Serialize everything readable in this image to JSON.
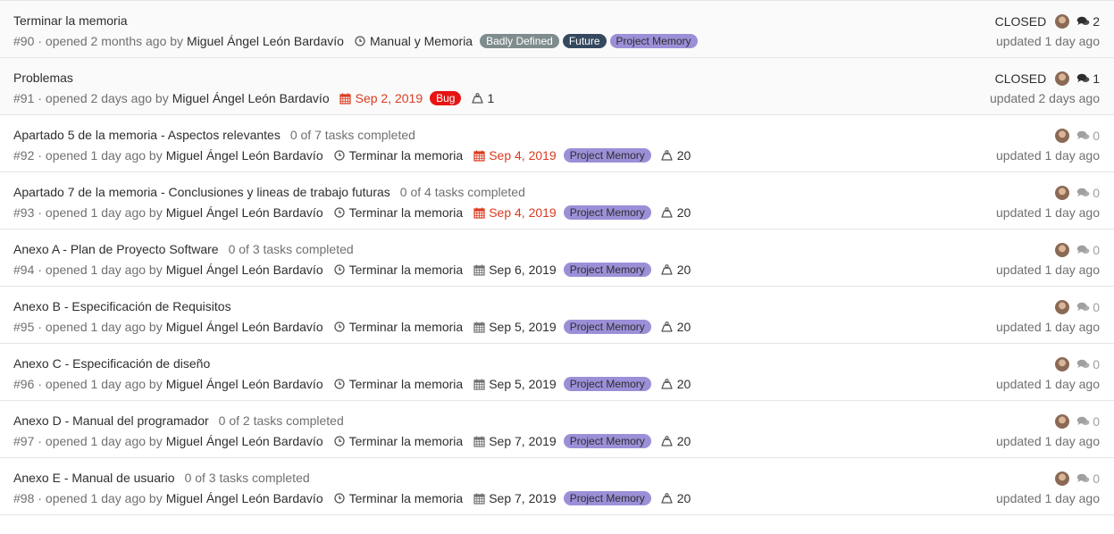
{
  "colors": {
    "badly_defined": "#7f8c8d",
    "future": "#34495e",
    "project_memory": "#9c8fd8",
    "bug": "#e81313",
    "overdue": "#db3b21"
  },
  "issues": [
    {
      "title": "Terminar la memoria",
      "tasks": "",
      "number": "#90",
      "opened": "· opened 2 months ago by",
      "author": "Miguel Ángel León Bardavío",
      "milestone": "Manual y Memoria",
      "due_date": "",
      "weight": "",
      "labels": [
        {
          "text": "Badly Defined",
          "color": "#7f8c8d",
          "text_color": "#ffffff"
        },
        {
          "text": "Future",
          "color": "#34495e",
          "text_color": "#ffffff"
        },
        {
          "text": "Project Memory",
          "color": "#9c8fd8",
          "text_color": "#2e2e2e"
        }
      ],
      "state": "CLOSED",
      "comments": "2",
      "updated": "updated 1 day ago"
    },
    {
      "title": "Problemas",
      "tasks": "",
      "number": "#91",
      "opened": "· opened 2 days ago by",
      "author": "Miguel Ángel León Bardavío",
      "milestone": "",
      "due_date": "Sep 2, 2019",
      "due_overdue": true,
      "weight": "1",
      "labels": [
        {
          "text": "Bug",
          "color": "#e81313",
          "text_color": "#ffffff"
        }
      ],
      "state": "CLOSED",
      "comments": "1",
      "updated": "updated 2 days ago"
    },
    {
      "title": "Apartado 5 de la memoria - Aspectos relevantes",
      "tasks": "0 of 7 tasks completed",
      "number": "#92",
      "opened": "· opened 1 day ago by",
      "author": "Miguel Ángel León Bardavío",
      "milestone": "Terminar la memoria",
      "due_date": "Sep 4, 2019",
      "due_overdue": true,
      "weight": "20",
      "labels": [
        {
          "text": "Project Memory",
          "color": "#9c8fd8",
          "text_color": "#2e2e2e"
        }
      ],
      "state": "",
      "comments": "0",
      "updated": "updated 1 day ago"
    },
    {
      "title": "Apartado 7 de la memoria - Conclusiones y lineas de trabajo futuras",
      "tasks": "0 of 4 tasks completed",
      "number": "#93",
      "opened": "· opened 1 day ago by",
      "author": "Miguel Ángel León Bardavío",
      "milestone": "Terminar la memoria",
      "due_date": "Sep 4, 2019",
      "due_overdue": true,
      "weight": "20",
      "labels": [
        {
          "text": "Project Memory",
          "color": "#9c8fd8",
          "text_color": "#2e2e2e"
        }
      ],
      "state": "",
      "comments": "0",
      "updated": "updated 1 day ago"
    },
    {
      "title": "Anexo A - Plan de Proyecto Software",
      "tasks": "0 of 3 tasks completed",
      "number": "#94",
      "opened": "· opened 1 day ago by",
      "author": "Miguel Ángel León Bardavío",
      "milestone": "Terminar la memoria",
      "due_date": "Sep 6, 2019",
      "due_overdue": false,
      "weight": "20",
      "labels": [
        {
          "text": "Project Memory",
          "color": "#9c8fd8",
          "text_color": "#2e2e2e"
        }
      ],
      "state": "",
      "comments": "0",
      "updated": "updated 1 day ago"
    },
    {
      "title": "Anexo B - Especificación de Requisitos",
      "tasks": "",
      "number": "#95",
      "opened": "· opened 1 day ago by",
      "author": "Miguel Ángel León Bardavío",
      "milestone": "Terminar la memoria",
      "due_date": "Sep 5, 2019",
      "due_overdue": false,
      "weight": "20",
      "labels": [
        {
          "text": "Project Memory",
          "color": "#9c8fd8",
          "text_color": "#2e2e2e"
        }
      ],
      "state": "",
      "comments": "0",
      "updated": "updated 1 day ago"
    },
    {
      "title": "Anexo C - Especificación de diseño",
      "tasks": "",
      "number": "#96",
      "opened": "· opened 1 day ago by",
      "author": "Miguel Ángel León Bardavío",
      "milestone": "Terminar la memoria",
      "due_date": "Sep 5, 2019",
      "due_overdue": false,
      "weight": "20",
      "labels": [
        {
          "text": "Project Memory",
          "color": "#9c8fd8",
          "text_color": "#2e2e2e"
        }
      ],
      "state": "",
      "comments": "0",
      "updated": "updated 1 day ago"
    },
    {
      "title": "Anexo D - Manual del programador",
      "tasks": "0 of 2 tasks completed",
      "number": "#97",
      "opened": "· opened 1 day ago by",
      "author": "Miguel Ángel León Bardavío",
      "milestone": "Terminar la memoria",
      "due_date": "Sep 7, 2019",
      "due_overdue": false,
      "weight": "20",
      "labels": [
        {
          "text": "Project Memory",
          "color": "#9c8fd8",
          "text_color": "#2e2e2e"
        }
      ],
      "state": "",
      "comments": "0",
      "updated": "updated 1 day ago"
    },
    {
      "title": "Anexo E - Manual de usuario",
      "tasks": "0 of 3 tasks completed",
      "number": "#98",
      "opened": "· opened 1 day ago by",
      "author": "Miguel Ángel León Bardavío",
      "milestone": "Terminar la memoria",
      "due_date": "Sep 7, 2019",
      "due_overdue": false,
      "weight": "20",
      "labels": [
        {
          "text": "Project Memory",
          "color": "#9c8fd8",
          "text_color": "#2e2e2e"
        }
      ],
      "state": "",
      "comments": "0",
      "updated": "updated 1 day ago"
    }
  ]
}
